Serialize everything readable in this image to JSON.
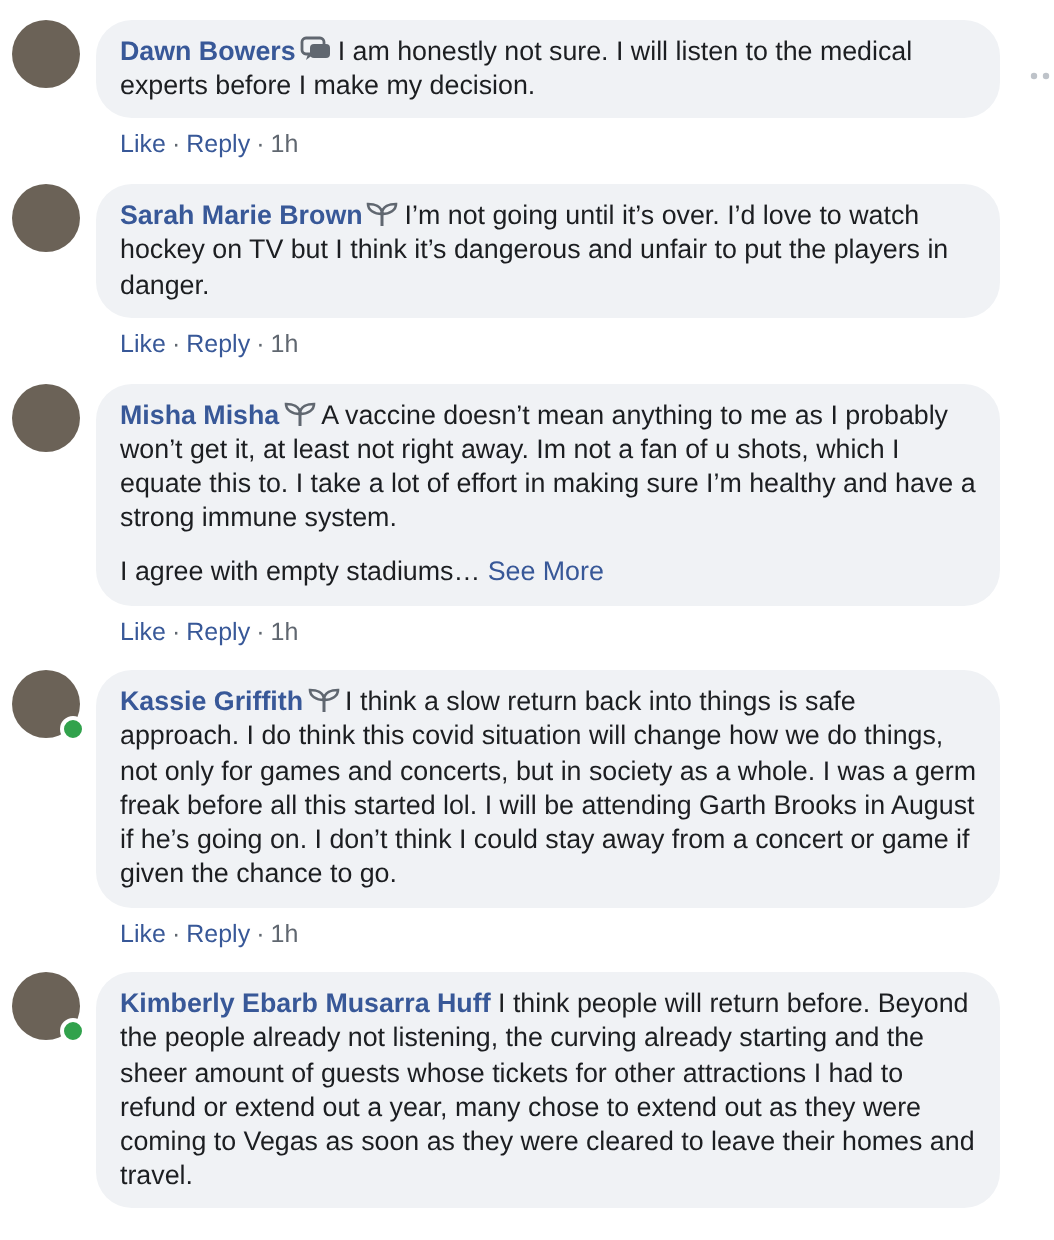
{
  "comments": [
    {
      "name": "Dawn Bowers",
      "kind": "conversation",
      "online": false,
      "more_menu": true,
      "paragraphs": [
        "I am honestly not sure. I will listen to the medical experts before I make my decision."
      ],
      "actions": [
        "Like",
        "Reply"
      ],
      "separator": "·",
      "time": "1h"
    },
    {
      "name": "Sarah Marie Brown",
      "kind": "sprout",
      "online": false,
      "paragraphs": [
        "I’m not going until it’s over. I’d love to watch hockey on TV but I think it’s dangerous and unfair to put the players in danger."
      ],
      "actions": [
        "Like",
        "Reply"
      ],
      "separator": "·",
      "time": "1h"
    },
    {
      "name": "Misha Misha",
      "kind": "sprout",
      "online": false,
      "paragraphs": [
        "A vaccine doesn’t mean anything to me as I probably won’t get it, at least not right away. Im not a fan of u shots, which I equate this to. I take a lot of effort in making sure I’m healthy and have a strong immune system.",
        "I agree with empty stadiums…"
      ],
      "see_more": "See More",
      "actions": [
        "Like",
        "Reply"
      ],
      "separator": "·",
      "time": "1h"
    },
    {
      "name": "Kassie Griffith",
      "kind": "sprout",
      "online": true,
      "paragraphs": [
        "I think a slow return back into things is safe approach. I do think this covid situation will change how we do things, not only for games and concerts, but in society as a whole. I was a germ freak before all this started lol. I will be attending Garth Brooks in August if he’s going on. I don’t think I could stay away from a concert or game if given the chance to go."
      ],
      "actions": [
        "Like",
        "Reply"
      ],
      "separator": "·",
      "time": "1h"
    },
    {
      "name": "Kimberly Ebarb Musarra Huff",
      "kind": "plain",
      "online": true,
      "paragraphs": [
        "I think people will return before. Beyond the people already not listening, the curving already starting and the sheer amount of guests whose tickets for other attractions I had to refund or extend out a year, many chose to extend out as they were coming to Vegas as soon as they were cleared to leave their homes and travel."
      ]
    }
  ]
}
